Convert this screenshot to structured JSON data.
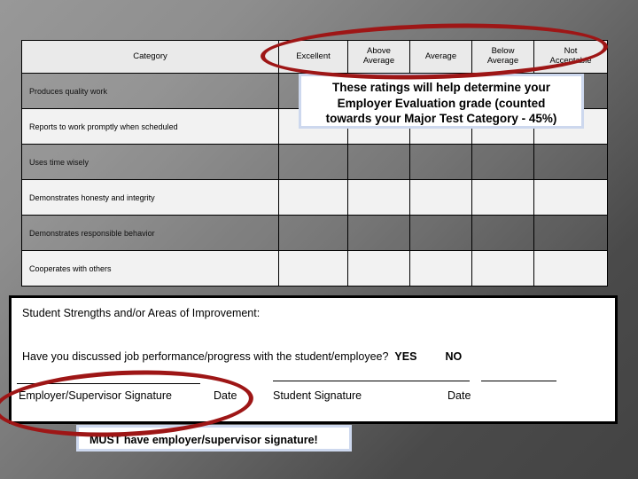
{
  "slide": {
    "background_top_left": "#989898",
    "background_bottom_right": "#434343",
    "annotation_color": "#9e1616"
  },
  "rating_table": {
    "headers": [
      "Category",
      "Excellent",
      "Above Average",
      "Average",
      "Below Average",
      "Not Acceptable"
    ],
    "header_lines": {
      "col0": "Category",
      "col1": "Excellent",
      "col2_line1": "Above",
      "col2_line2": "Average",
      "col3": "Average",
      "col4_line1": "Below",
      "col4_line2": "Average",
      "col5_line1": "Not",
      "col5_line2": "Acceptable"
    },
    "rows": [
      {
        "category": "Produces quality work"
      },
      {
        "category": "Reports to work promptly when scheduled"
      },
      {
        "category": "Uses time wisely"
      },
      {
        "category": "Demonstrates honesty and integrity"
      },
      {
        "category": "Demonstrates responsible behavior"
      },
      {
        "category": "Cooperates with others"
      }
    ]
  },
  "ratings_callout": {
    "line1": "These ratings will help determine your",
    "line2": "Employer Evaluation grade (counted",
    "line3": "towards your Major Test Category  - 45%)",
    "border_color": "#cdd8ee"
  },
  "bottom_panel": {
    "strengths_label": "Student Strengths and/or Areas of Improvement:",
    "discussed_question": "Have you discussed job performance/progress with the student/employee?",
    "yes_label": "YES",
    "no_label": "NO",
    "employer_signature_caption": "Employer/Supervisor Signature",
    "date_caption_1": "Date",
    "student_signature_caption": "Student Signature",
    "date_caption_2": "Date"
  },
  "signature_callout": {
    "must_word": "MUST",
    "rest_text": " have employer/supervisor signature!",
    "border_color": "#cdd8ee"
  }
}
